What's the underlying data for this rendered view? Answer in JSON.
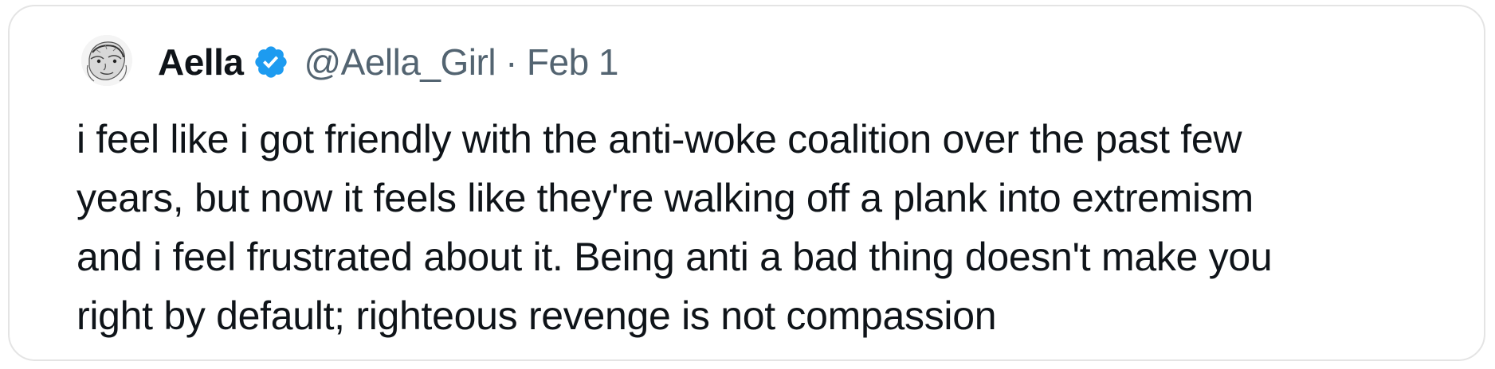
{
  "tweet": {
    "author_name": "Aella",
    "author_handle": "@Aella_Girl",
    "separator": "·",
    "date": "Feb 1",
    "verified": true,
    "text_lines": [
      "i feel like i got friendly with the anti-woke coalition over the past few",
      "years, but now it feels like they're walking off a plank into extremism",
      "and i feel frustrated about it. Being anti a bad thing doesn't make you",
      "right by default; righteous revenge is not compassion"
    ]
  },
  "colors": {
    "text": "#0f1419",
    "secondary_text": "#536471",
    "verified_badge": "#1d9bf0",
    "border": "#e4e4e4"
  },
  "icons": {
    "avatar": "sketch-portrait-avatar",
    "verified": "verified-badge-icon"
  }
}
